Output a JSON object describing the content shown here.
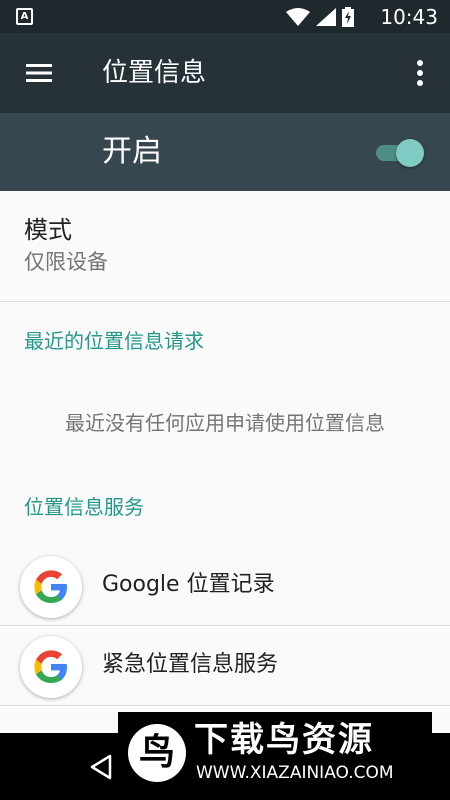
{
  "status_bar": {
    "time": "10:43",
    "notification_glyph": "A"
  },
  "app_bar": {
    "title": "位置信息"
  },
  "master_switch": {
    "label": "开启",
    "on": true
  },
  "mode": {
    "title": "模式",
    "value": "仅限设备"
  },
  "recent_requests": {
    "header": "最近的位置信息请求",
    "empty_message": "最近没有任何应用申请使用位置信息"
  },
  "location_services": {
    "header": "位置信息服务",
    "items": [
      {
        "label": "Google 位置记录",
        "icon": "google-g-icon"
      },
      {
        "label": "紧急位置信息服务",
        "icon": "google-g-icon"
      }
    ]
  },
  "watermark": {
    "brand": "下载鸟资源",
    "url": "WWW.XIAZAINIAO.COM",
    "logo_glyph": "鸟"
  },
  "colors": {
    "accent": "#26978b",
    "app_bar": "#263238",
    "switch_bar": "#37474f",
    "toggle_thumb": "#80cbc4"
  }
}
